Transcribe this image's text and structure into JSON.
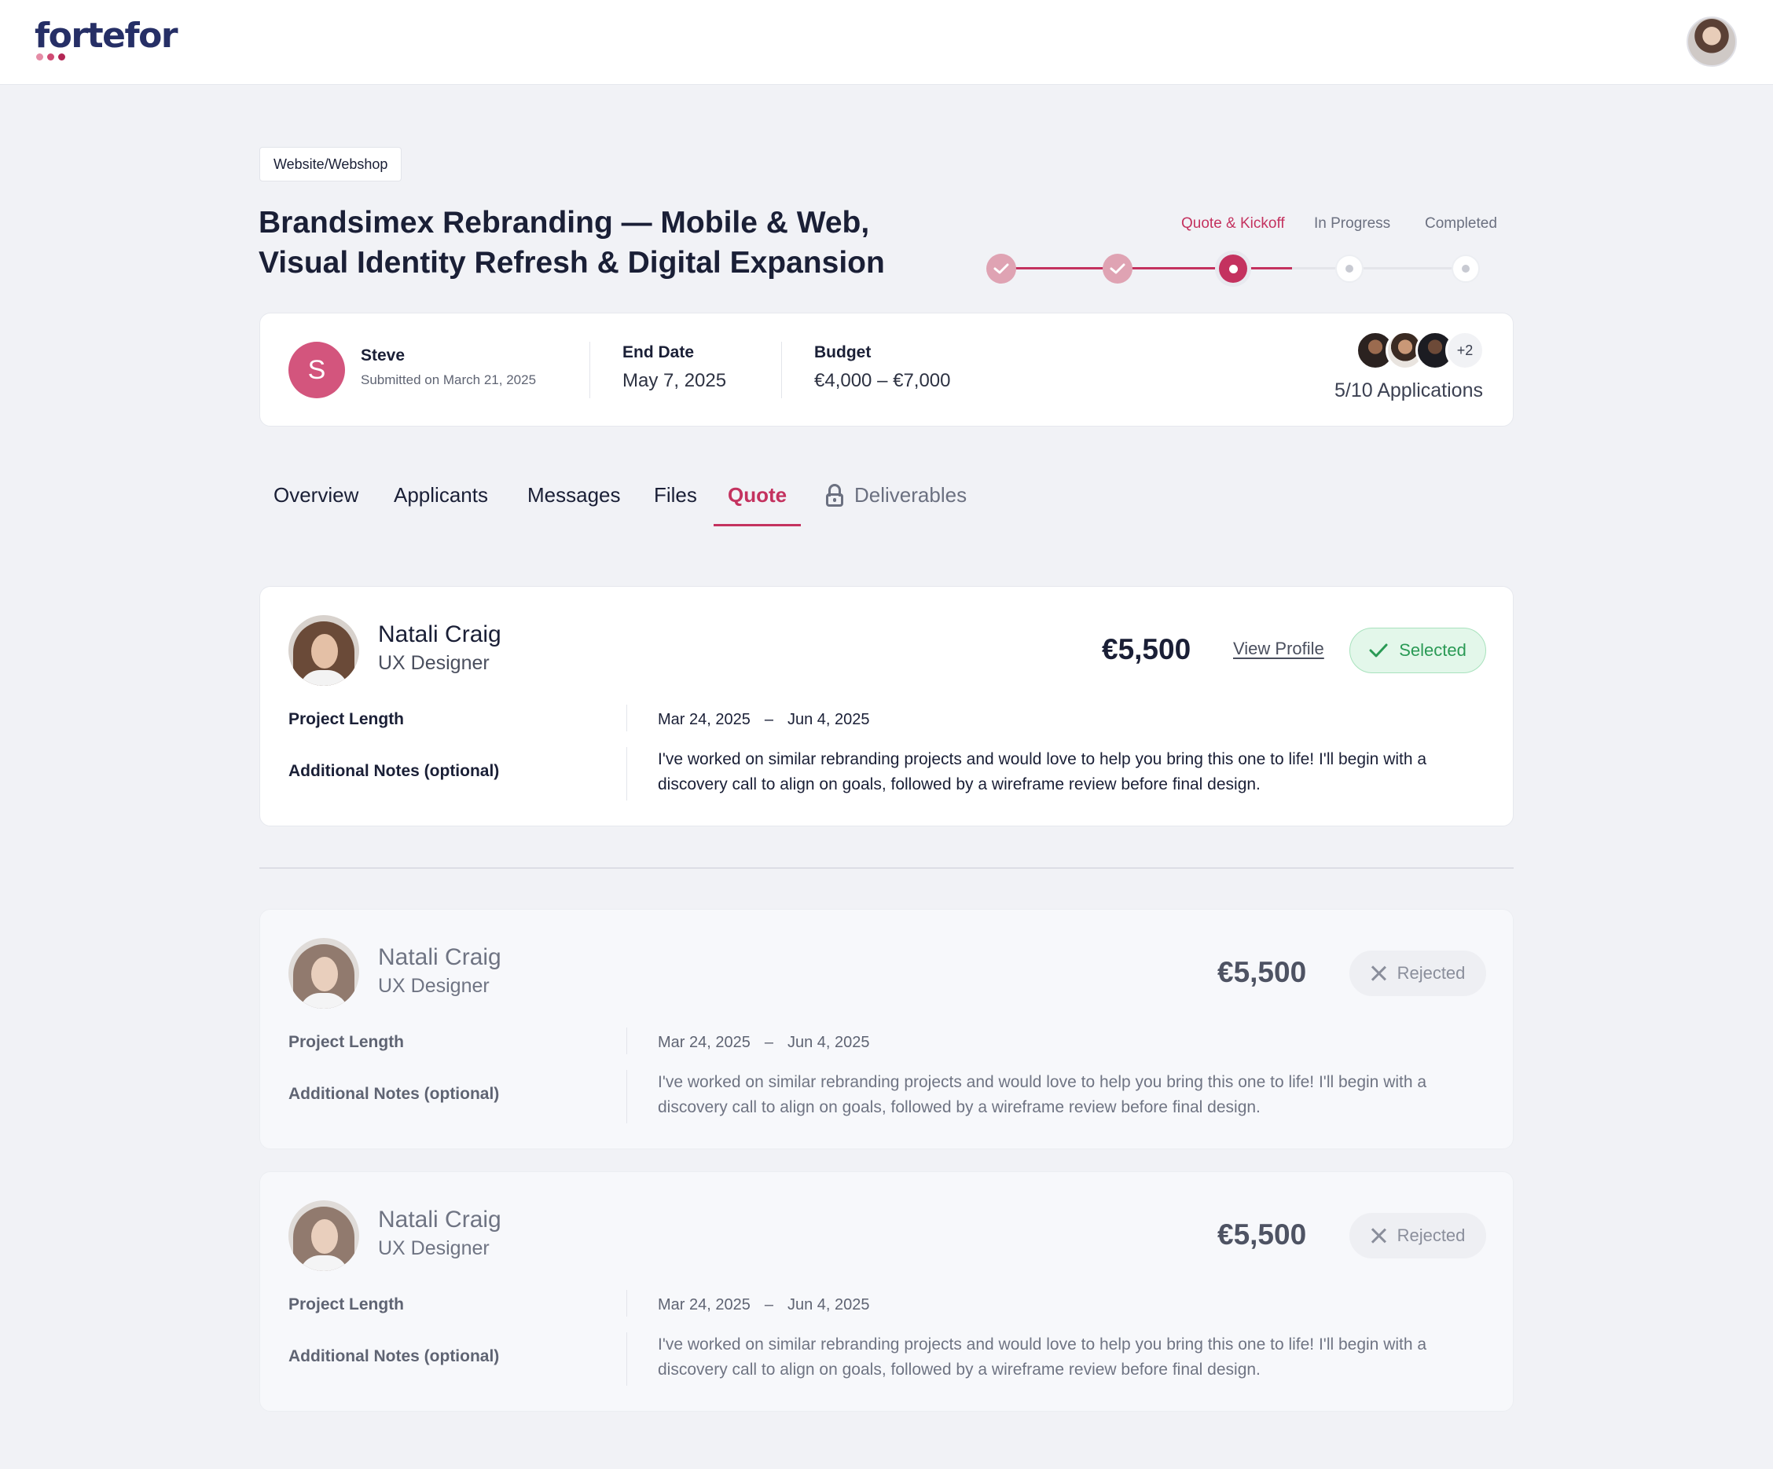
{
  "header": {
    "logo_text": "fortefor"
  },
  "project": {
    "category": "Website/Webshop",
    "title": "Brandsimex Rebranding — Mobile & Web, Visual Identity Refresh & Digital Expansion"
  },
  "progress": {
    "steps": [
      "Quote & Kickoff",
      "In Progress",
      "Completed"
    ],
    "active_step": "Quote & Kickoff",
    "accent_color": "#c4325f"
  },
  "summary": {
    "client_initial": "S",
    "client_name": "Steve",
    "submitted": "Submitted on March 21, 2025",
    "end_date_label": "End Date",
    "end_date": "May 7, 2025",
    "budget_label": "Budget",
    "budget": "€4,000 – €7,000",
    "more_applicants": "+2",
    "applications": "5/10 Applications"
  },
  "tabs": [
    {
      "label": "Overview"
    },
    {
      "label": "Applicants"
    },
    {
      "label": "Messages"
    },
    {
      "label": "Files"
    },
    {
      "label": "Quote"
    },
    {
      "label": "Deliverables"
    }
  ],
  "active_tab": "Quote",
  "quotes": [
    {
      "name": "Natali Craig",
      "role": "UX Designer",
      "price": "€5,500",
      "view_profile": "View Profile",
      "status": "Selected",
      "length_label": "Project Length",
      "start": "Mar 24, 2025",
      "dash": "–",
      "end": "Jun 4, 2025",
      "notes_label": "Additional Notes (optional)",
      "notes": "I've worked on similar rebranding projects and would love to help you bring this one to life! I'll begin with a discovery call to align on goals, followed by a wireframe review before final design."
    },
    {
      "name": "Natali Craig",
      "role": "UX Designer",
      "price": "€5,500",
      "status": "Rejected",
      "length_label": "Project Length",
      "start": "Mar 24, 2025",
      "dash": "–",
      "end": "Jun 4, 2025",
      "notes_label": "Additional Notes (optional)",
      "notes": "I've worked on similar rebranding projects and would love to help you bring this one to life! I'll begin with a discovery call to align on goals, followed by a wireframe review before final design."
    },
    {
      "name": "Natali Craig",
      "role": "UX Designer",
      "price": "€5,500",
      "status": "Rejected",
      "length_label": "Project Length",
      "start": "Mar 24, 2025",
      "dash": "–",
      "end": "Jun 4, 2025",
      "notes_label": "Additional Notes (optional)",
      "notes": "I've worked on similar rebranding projects and would love to help you bring this one to life! I'll begin with a discovery call to align on goals, followed by a wireframe review before final design."
    }
  ]
}
